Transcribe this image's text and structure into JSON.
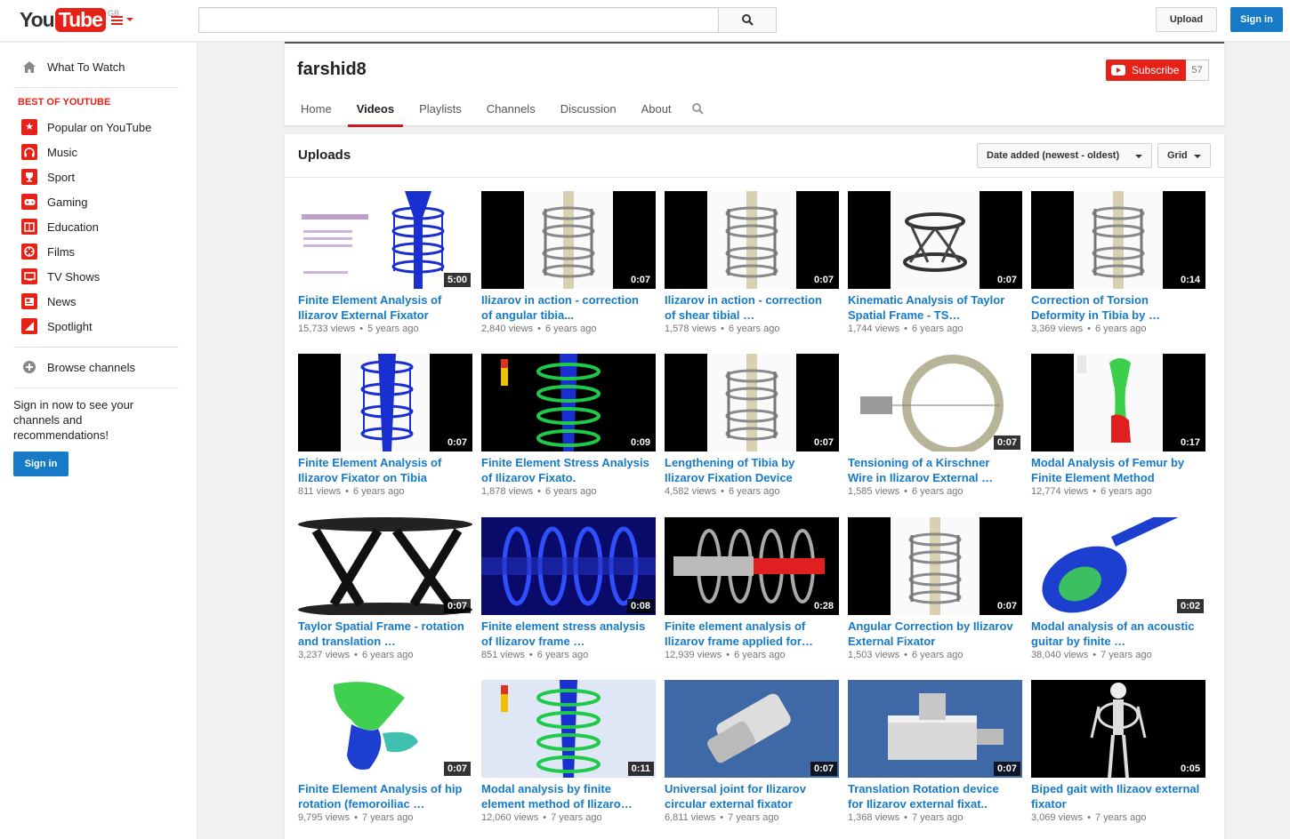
{
  "masthead": {
    "logo_you": "You",
    "logo_tube": "Tube",
    "region": "GB",
    "search_placeholder": "",
    "upload_label": "Upload",
    "signin_label": "Sign in"
  },
  "guide": {
    "what_to_watch": "What To Watch",
    "section_title": "BEST OF YOUTUBE",
    "items": [
      {
        "label": "Popular on YouTube",
        "icon": "star-icon"
      },
      {
        "label": "Music",
        "icon": "headphones-icon"
      },
      {
        "label": "Sport",
        "icon": "trophy-icon"
      },
      {
        "label": "Gaming",
        "icon": "gamepad-icon"
      },
      {
        "label": "Education",
        "icon": "book-icon"
      },
      {
        "label": "Films",
        "icon": "film-reel-icon"
      },
      {
        "label": "TV Shows",
        "icon": "tv-icon"
      },
      {
        "label": "News",
        "icon": "newspaper-icon"
      },
      {
        "label": "Spotlight",
        "icon": "spotlight-icon"
      }
    ],
    "browse_channels": "Browse channels",
    "signin_promo": "Sign in now to see your channels and recommendations!",
    "signin_label": "Sign in"
  },
  "channel": {
    "title": "farshid8",
    "subscribe_label": "Subscribe",
    "subscriber_count": "57",
    "tabs": [
      "Home",
      "Videos",
      "Playlists",
      "Channels",
      "Discussion",
      "About"
    ],
    "active_tab": "Videos"
  },
  "uploads": {
    "title": "Uploads",
    "sort_label": "Date added (newest - oldest)",
    "view_label": "Grid",
    "videos": [
      {
        "title": "Finite Element Analysis of Ilizarov External Fixator",
        "views": "15,733 views",
        "age": "5 years ago",
        "duration": "5:00"
      },
      {
        "title": "Ilizarov in action - correction of angular tibia...",
        "views": "2,840 views",
        "age": "6 years ago",
        "duration": "0:07"
      },
      {
        "title": "Ilizarov in action - correction of shear tibial …",
        "views": "1,578 views",
        "age": "6 years ago",
        "duration": "0:07"
      },
      {
        "title": "Kinematic Analysis of Taylor Spatial Frame - TS…",
        "views": "1,744 views",
        "age": "6 years ago",
        "duration": "0:07"
      },
      {
        "title": "Correction of Torsion Deformity in Tibia by …",
        "views": "3,369 views",
        "age": "6 years ago",
        "duration": "0:14"
      },
      {
        "title": "Finite Element Analysis of Ilizarov Fixator on Tibia",
        "views": "811 views",
        "age": "6 years ago",
        "duration": "0:07"
      },
      {
        "title": "Finite Element Stress Analysis of Ilizarov Fixato.",
        "views": "1,878 views",
        "age": "6 years ago",
        "duration": "0:09"
      },
      {
        "title": "Lengthening of Tibia by Ilizarov Fixation Device",
        "views": "4,582 views",
        "age": "6 years ago",
        "duration": "0:07"
      },
      {
        "title": "Tensioning of a Kirschner Wire in Ilizarov External …",
        "views": "1,585 views",
        "age": "6 years ago",
        "duration": "0:07"
      },
      {
        "title": "Modal Analysis of Femur by Finite Element Method",
        "views": "12,774 views",
        "age": "6 years ago",
        "duration": "0:17"
      },
      {
        "title": "Taylor Spatial Frame - rotation and translation …",
        "views": "3,237 views",
        "age": "6 years ago",
        "duration": "0:07"
      },
      {
        "title": "Finite element stress analysis of Ilizarov frame …",
        "views": "851 views",
        "age": "6 years ago",
        "duration": "0:08"
      },
      {
        "title": "Finite element analysis of Ilizarov frame applied for…",
        "views": "12,939 views",
        "age": "6 years ago",
        "duration": "0:28"
      },
      {
        "title": "Angular Correction by Ilizarov External Fixator",
        "views": "1,503 views",
        "age": "6 years ago",
        "duration": "0:07"
      },
      {
        "title": "Modal analysis of an acoustic guitar by finite …",
        "views": "38,040 views",
        "age": "7 years ago",
        "duration": "0:02"
      },
      {
        "title": "Finite Element Analysis of hip rotation (femoroiliac …",
        "views": "9,795 views",
        "age": "7 years ago",
        "duration": "0:07"
      },
      {
        "title": "Modal analysis by finite element method of Ilizaro…",
        "views": "12,060 views",
        "age": "7 years ago",
        "duration": "0:11"
      },
      {
        "title": "Universal joint for Ilizarov circular external fixator",
        "views": "6,811 views",
        "age": "7 years ago",
        "duration": "0:07"
      },
      {
        "title": "Translation Rotation device for Ilizarov external fixat..",
        "views": "1,368 views",
        "age": "7 years ago",
        "duration": "0:07"
      },
      {
        "title": "Biped gait with Ilizaov external fixator",
        "views": "3,069 views",
        "age": "7 years ago",
        "duration": "0:05"
      }
    ]
  },
  "colors": {
    "brand_red": "#e62117",
    "link_blue": "#167ac6",
    "tab_underline": "#cc181e"
  }
}
